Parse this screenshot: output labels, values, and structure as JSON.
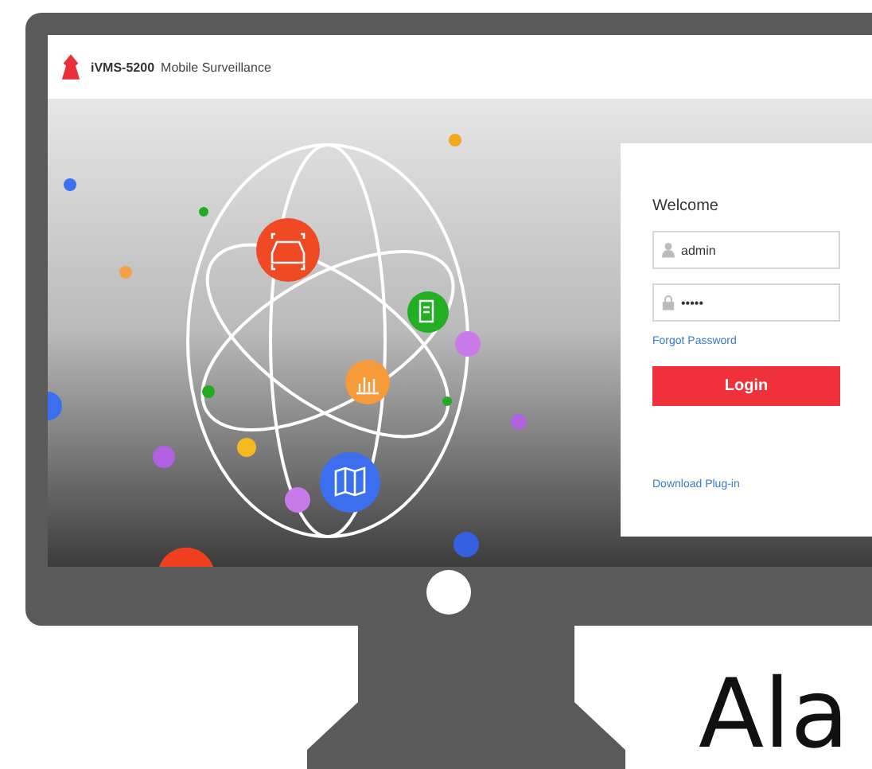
{
  "header": {
    "brand": "iVMS-5200",
    "product": "Mobile Surveillance"
  },
  "login": {
    "title": "Welcome",
    "username": {
      "value": "admin"
    },
    "password": {
      "value": "•••••"
    },
    "forgot_link": "Forgot Password",
    "button": "Login",
    "download_link": "Download Plug-in"
  },
  "caption": "Ala"
}
